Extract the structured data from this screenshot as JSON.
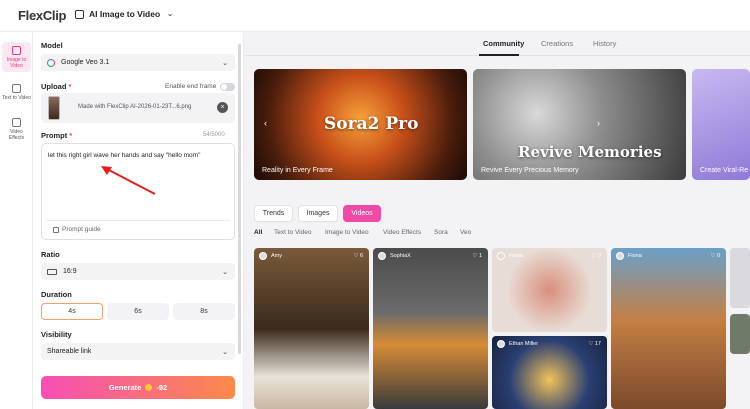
{
  "app": {
    "logo_text": "FlexClip",
    "tool_name": "AI Image to Video"
  },
  "rail": [
    {
      "label": "Image to Video"
    },
    {
      "label": "Text to Video"
    },
    {
      "label": "Video Effects"
    }
  ],
  "panel": {
    "model_label": "Model",
    "model_value": "Google Veo 3.1",
    "upload_label": "Upload",
    "end_frame_label": "Enable end frame",
    "upload_file": "Made with FlexClip AI-2026-01-23T...6.png",
    "prompt_label": "Prompt",
    "prompt_count": "54/5000",
    "prompt_text": "let this right girl wave her hands and say \"hello mom\"",
    "prompt_guide": "Prompt guide",
    "ratio_label": "Ratio",
    "ratio_value": "16:9",
    "duration_label": "Duration",
    "durations": [
      "4s",
      "6s",
      "8s"
    ],
    "visibility_label": "Visibility",
    "visibility_value": "Shareable link",
    "generate_label": "Generate",
    "generate_cost": "-92"
  },
  "main": {
    "tabs": [
      "Community",
      "Creations",
      "History"
    ],
    "banners": [
      {
        "title": "Sora2 Pro",
        "caption": "Reality in Every Frame"
      },
      {
        "title": "Revive Memories",
        "caption": "Revive Every Precious Memory"
      },
      {
        "title": "",
        "caption": "Create Viral-Re"
      }
    ],
    "filters": [
      "Trends",
      "Images",
      "Videos"
    ],
    "subfilters": [
      "All",
      "Text to Video",
      "Image to Video",
      "Video Effects",
      "Sora",
      "Veo"
    ],
    "cards": [
      {
        "user": "Amy",
        "likes": "6"
      },
      {
        "user": "SophiaX",
        "likes": "1"
      },
      {
        "user": "Fiona",
        "likes": "0"
      },
      {
        "user": "Fiona",
        "likes": "0"
      },
      {
        "user": "Ethan Miller",
        "likes": "17"
      }
    ]
  },
  "colors": {
    "accent": "#f04aa8",
    "generate_start": "#f54fb4",
    "generate_end": "#fb8a4a",
    "duration_selected": "#f0a070"
  }
}
